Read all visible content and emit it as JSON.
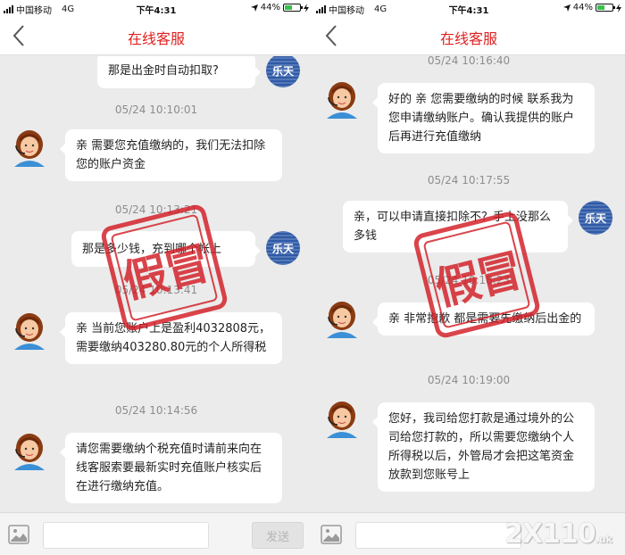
{
  "status_bar": {
    "carrier": "中国移动",
    "network": "4G",
    "time": "下午4:31",
    "battery": "44%",
    "battery_level": 0.44
  },
  "nav": {
    "title": "在线客服"
  },
  "avatars": {
    "user_label": "乐天"
  },
  "input_bar": {
    "send_label": "发送"
  },
  "stamp_text": "假冒",
  "watermark": "2X110",
  "watermark_suffix": ".uk",
  "left_chat": {
    "msg1": "那是出金时自动扣取?",
    "ts1": "05/24 10:10:01",
    "msg2": "亲 需要您充值缴纳的，我们无法扣除您的账户资金",
    "ts2": "05/24 10:13:21",
    "msg3": "那是多少钱，充到哪个帐上",
    "ts3": "05/24 10:13:41",
    "msg4": "亲 当前您账户上是盈利4032808元，需要缴纳403280.80元的个人所得税",
    "ts4": "05/24 10:14:56",
    "msg5": "请您需要缴纳个税充值时请前来向在线客服索要最新实时充值账户核实后在进行缴纳充值。"
  },
  "right_chat": {
    "ts0": "05/24 10:16:40",
    "msg1": "好的 亲 您需要缴纳的时候 联系我为您申请缴纳账户。确认我提供的账户后再进行充值缴纳",
    "ts1": "05/24 10:17:55",
    "msg2": "亲，可以申请直接扣除不？手上没那么多钱",
    "ts2": "05/24 10:18:23",
    "msg3": "亲 非常抱歉 都是需要先缴纳后出金的",
    "ts3": "05/24 10:19:00",
    "msg4": "您好，我司给您打款是通过境外的公司给您打款的，所以需要您缴纳个人所得税以后，外管局才会把这笔资金放款到您账号上"
  },
  "colors": {
    "title_red": "#e02020",
    "stamp_red": "#d21c24",
    "chat_bg": "#ebebeb",
    "user_avatar_blue": "#2f5aa7"
  }
}
